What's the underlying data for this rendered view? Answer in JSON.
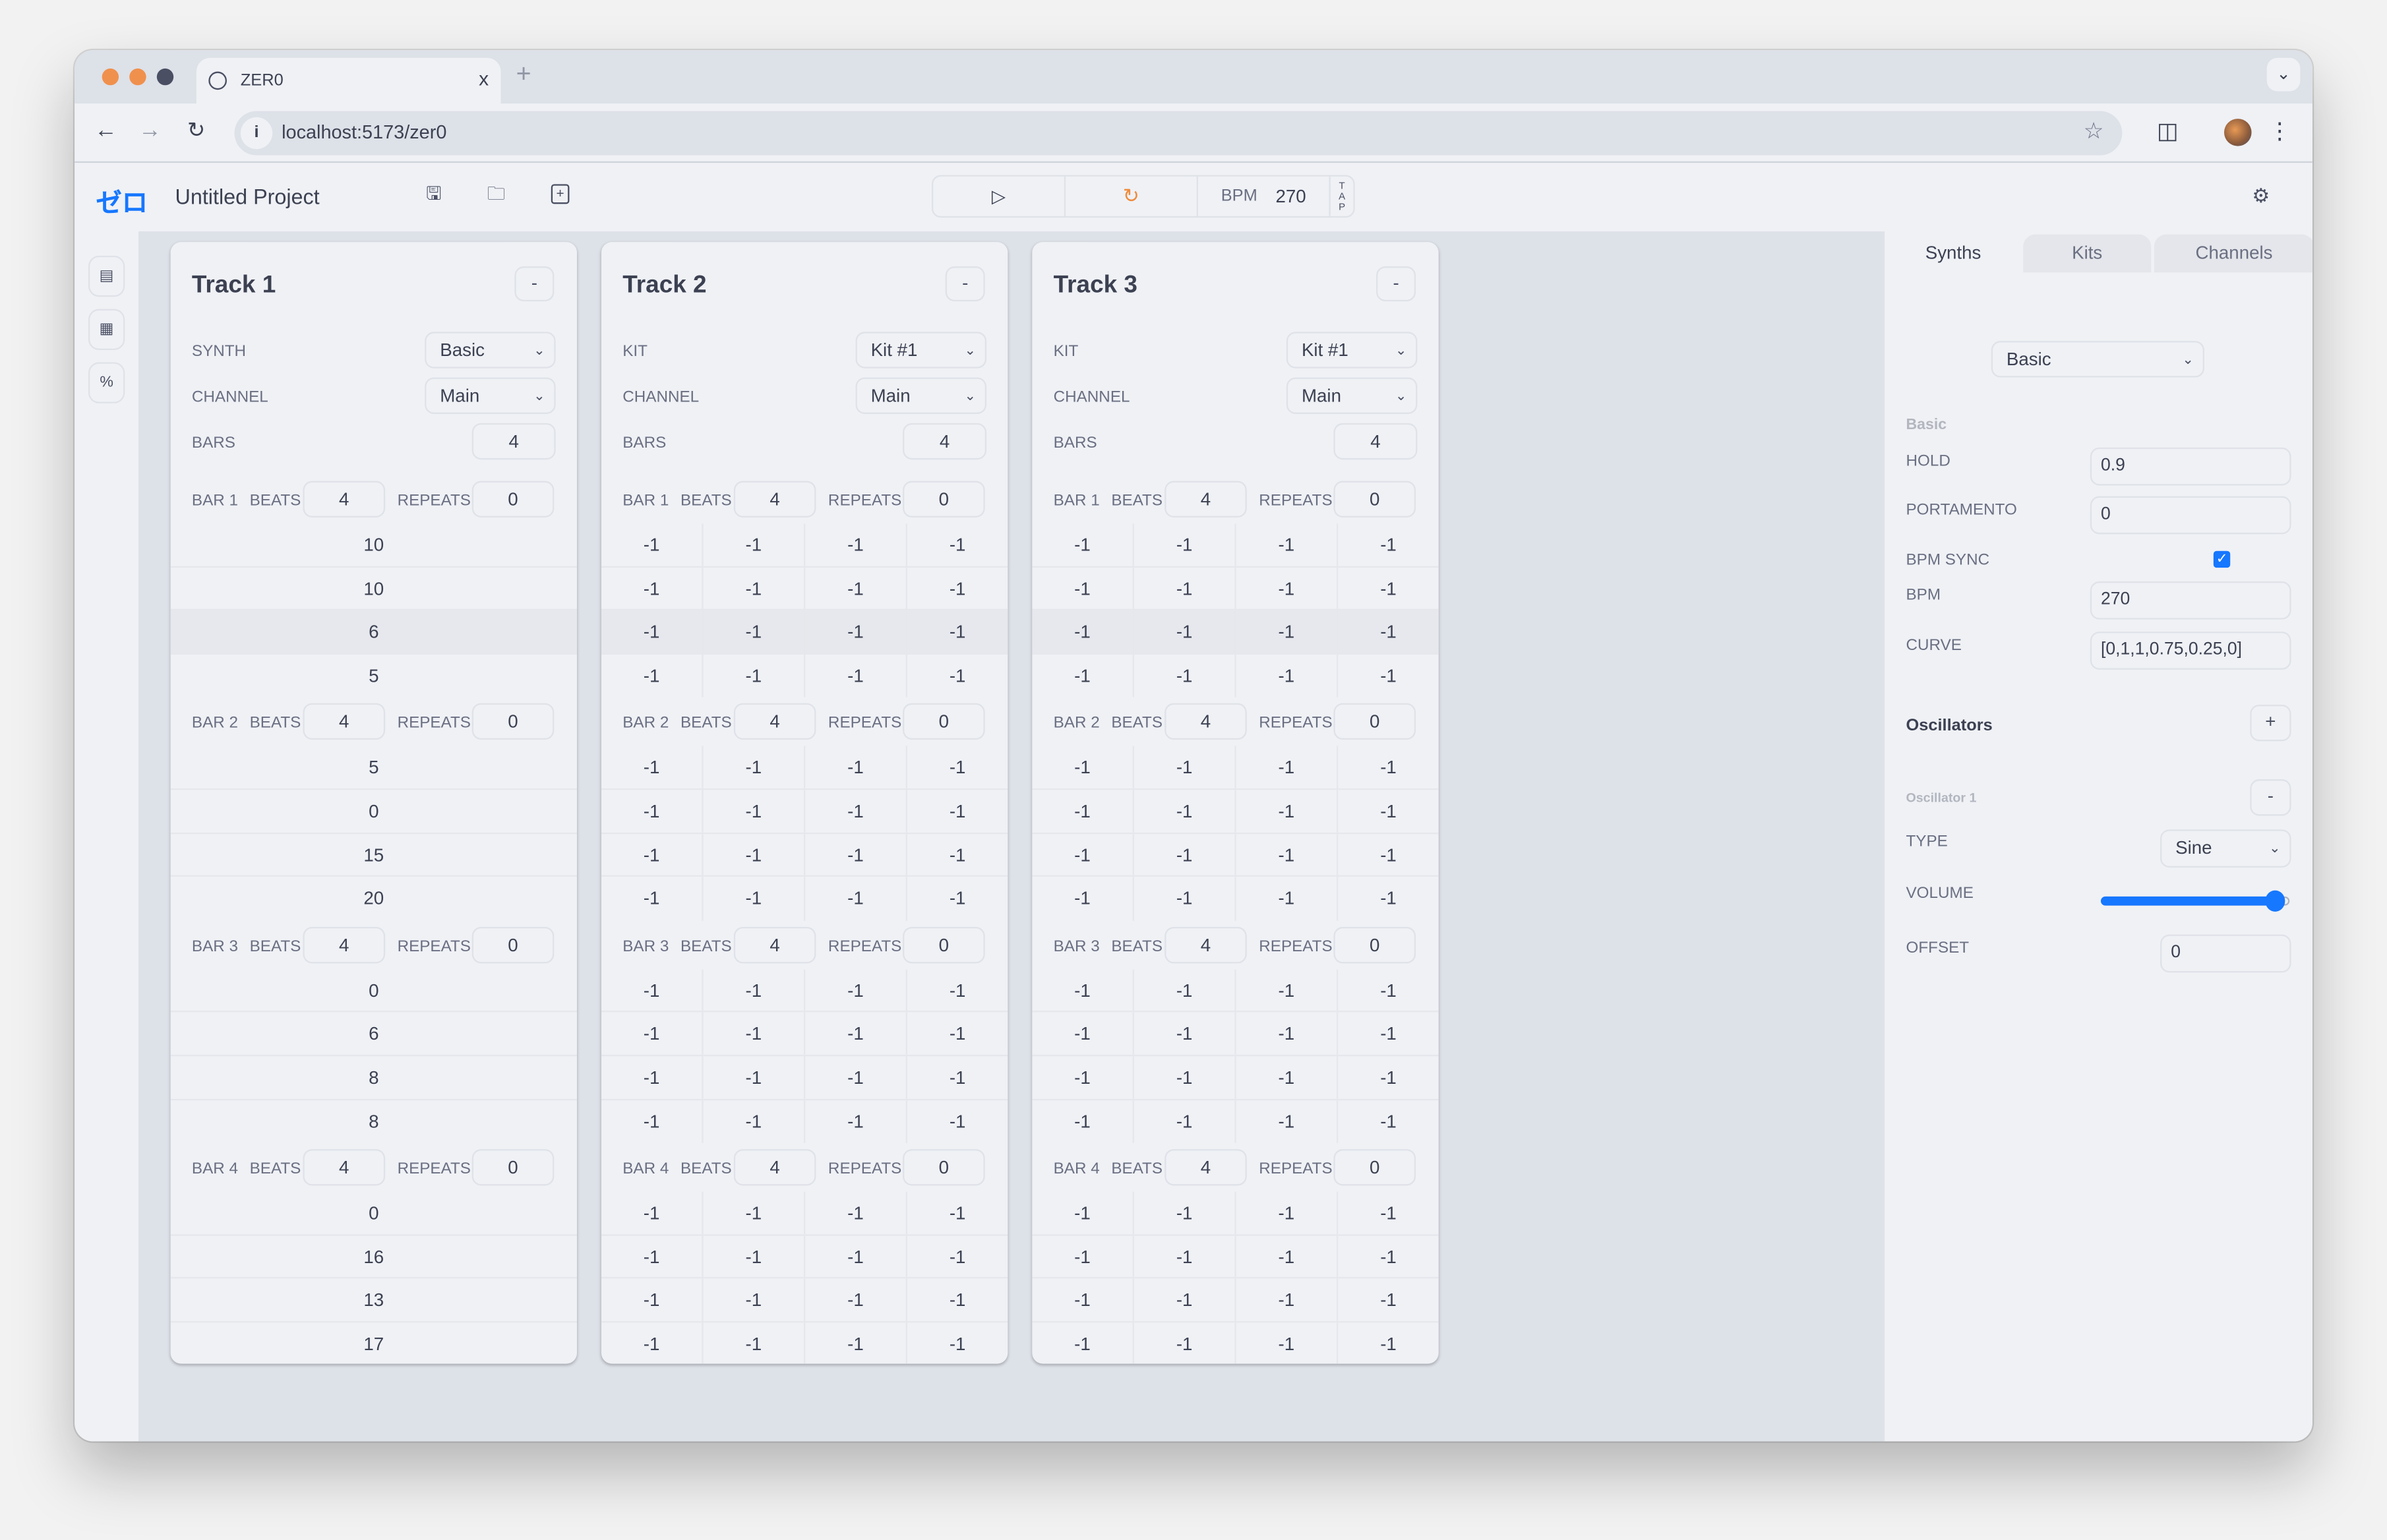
{
  "browser": {
    "tab_title": "ZER0",
    "url": "localhost:5173/zer0",
    "new_tab": "+",
    "close": "x"
  },
  "app": {
    "logo": "ゼロ",
    "project_title": "Untitled Project",
    "transport": {
      "bpm_label": "BPM",
      "bpm_value": "270",
      "tap_label": [
        "T",
        "A",
        "P"
      ]
    }
  },
  "tracks": [
    {
      "name": "Track 1",
      "remove_label": "-",
      "source_label": "SYNTH",
      "source_value": "Basic",
      "channel_label": "CHANNEL",
      "channel_value": "Main",
      "bars_label": "BARS",
      "bars_value": "4",
      "bars": [
        {
          "label": "BAR 1",
          "beats_label": "BEATS",
          "beats": "4",
          "repeats_label": "REPEATS",
          "repeats": "0",
          "rows": [
            [
              "10"
            ],
            [
              "10"
            ],
            [
              "6"
            ],
            [
              "5"
            ]
          ]
        },
        {
          "label": "BAR 2",
          "beats_label": "BEATS",
          "beats": "4",
          "repeats_label": "REPEATS",
          "repeats": "0",
          "rows": [
            [
              "5"
            ],
            [
              "0"
            ],
            [
              "15"
            ],
            [
              "20"
            ]
          ]
        },
        {
          "label": "BAR 3",
          "beats_label": "BEATS",
          "beats": "4",
          "repeats_label": "REPEATS",
          "repeats": "0",
          "rows": [
            [
              "0"
            ],
            [
              "6"
            ],
            [
              "8"
            ],
            [
              "8"
            ]
          ]
        },
        {
          "label": "BAR 4",
          "beats_label": "BEATS",
          "beats": "4",
          "repeats_label": "REPEATS",
          "repeats": "0",
          "rows": [
            [
              "0"
            ],
            [
              "16"
            ],
            [
              "13"
            ],
            [
              "17"
            ]
          ]
        }
      ]
    },
    {
      "name": "Track 2",
      "remove_label": "-",
      "source_label": "KIT",
      "source_value": "Kit #1",
      "channel_label": "CHANNEL",
      "channel_value": "Main",
      "bars_label": "BARS",
      "bars_value": "4",
      "bars": [
        {
          "label": "BAR 1",
          "beats_label": "BEATS",
          "beats": "4",
          "repeats_label": "REPEATS",
          "repeats": "0",
          "rows": [
            [
              "-1",
              "-1",
              "-1",
              "-1"
            ],
            [
              "-1",
              "-1",
              "-1",
              "-1"
            ],
            [
              "-1",
              "-1",
              "-1",
              "-1"
            ],
            [
              "-1",
              "-1",
              "-1",
              "-1"
            ]
          ]
        },
        {
          "label": "BAR 2",
          "beats_label": "BEATS",
          "beats": "4",
          "repeats_label": "REPEATS",
          "repeats": "0",
          "rows": [
            [
              "-1",
              "-1",
              "-1",
              "-1"
            ],
            [
              "-1",
              "-1",
              "-1",
              "-1"
            ],
            [
              "-1",
              "-1",
              "-1",
              "-1"
            ],
            [
              "-1",
              "-1",
              "-1",
              "-1"
            ]
          ]
        },
        {
          "label": "BAR 3",
          "beats_label": "BEATS",
          "beats": "4",
          "repeats_label": "REPEATS",
          "repeats": "0",
          "rows": [
            [
              "-1",
              "-1",
              "-1",
              "-1"
            ],
            [
              "-1",
              "-1",
              "-1",
              "-1"
            ],
            [
              "-1",
              "-1",
              "-1",
              "-1"
            ],
            [
              "-1",
              "-1",
              "-1",
              "-1"
            ]
          ]
        },
        {
          "label": "BAR 4",
          "beats_label": "BEATS",
          "beats": "4",
          "repeats_label": "REPEATS",
          "repeats": "0",
          "rows": [
            [
              "-1",
              "-1",
              "-1",
              "-1"
            ],
            [
              "-1",
              "-1",
              "-1",
              "-1"
            ],
            [
              "-1",
              "-1",
              "-1",
              "-1"
            ],
            [
              "-1",
              "-1",
              "-1",
              "-1"
            ]
          ]
        }
      ]
    },
    {
      "name": "Track 3",
      "remove_label": "-",
      "source_label": "KIT",
      "source_value": "Kit #1",
      "channel_label": "CHANNEL",
      "channel_value": "Main",
      "bars_label": "BARS",
      "bars_value": "4",
      "bars": [
        {
          "label": "BAR 1",
          "beats_label": "BEATS",
          "beats": "4",
          "repeats_label": "REPEATS",
          "repeats": "0",
          "rows": [
            [
              "-1",
              "-1",
              "-1",
              "-1"
            ],
            [
              "-1",
              "-1",
              "-1",
              "-1"
            ],
            [
              "-1",
              "-1",
              "-1",
              "-1"
            ],
            [
              "-1",
              "-1",
              "-1",
              "-1"
            ]
          ]
        },
        {
          "label": "BAR 2",
          "beats_label": "BEATS",
          "beats": "4",
          "repeats_label": "REPEATS",
          "repeats": "0",
          "rows": [
            [
              "-1",
              "-1",
              "-1",
              "-1"
            ],
            [
              "-1",
              "-1",
              "-1",
              "-1"
            ],
            [
              "-1",
              "-1",
              "-1",
              "-1"
            ],
            [
              "-1",
              "-1",
              "-1",
              "-1"
            ]
          ]
        },
        {
          "label": "BAR 3",
          "beats_label": "BEATS",
          "beats": "4",
          "repeats_label": "REPEATS",
          "repeats": "0",
          "rows": [
            [
              "-1",
              "-1",
              "-1",
              "-1"
            ],
            [
              "-1",
              "-1",
              "-1",
              "-1"
            ],
            [
              "-1",
              "-1",
              "-1",
              "-1"
            ],
            [
              "-1",
              "-1",
              "-1",
              "-1"
            ]
          ]
        },
        {
          "label": "BAR 4",
          "beats_label": "BEATS",
          "beats": "4",
          "repeats_label": "REPEATS",
          "repeats": "0",
          "rows": [
            [
              "-1",
              "-1",
              "-1",
              "-1"
            ],
            [
              "-1",
              "-1",
              "-1",
              "-1"
            ],
            [
              "-1",
              "-1",
              "-1",
              "-1"
            ],
            [
              "-1",
              "-1",
              "-1",
              "-1"
            ]
          ]
        }
      ]
    }
  ],
  "highlighted_row_index": 2,
  "panel": {
    "tabs": [
      "Synths",
      "Kits",
      "Channels"
    ],
    "active_tab": "Synths",
    "synth_select": "Basic",
    "section_name": "Basic",
    "fields": {
      "hold_label": "HOLD",
      "hold": "0.9",
      "portamento_label": "PORTAMENTO",
      "portamento": "0",
      "bpm_sync_label": "BPM SYNC",
      "bpm_sync": true,
      "bpm_label": "BPM",
      "bpm": "270",
      "curve_label": "CURVE",
      "curve": "[0,1,1,0.75,0.25,0]"
    },
    "oscillators_title": "Oscillators",
    "add_label": "+",
    "oscillator": {
      "name": "Oscillator 1",
      "remove_label": "-",
      "type_label": "TYPE",
      "type": "Sine",
      "volume_label": "VOLUME",
      "volume": 0.92,
      "offset_label": "OFFSET",
      "offset": "0"
    }
  },
  "colors": {
    "accent": "#1677ff",
    "loop_icon": "#ef8b3c",
    "traffic_red": "#f0904d",
    "traffic_yellow": "#f0904d",
    "traffic_dark": "#4a4f63"
  }
}
